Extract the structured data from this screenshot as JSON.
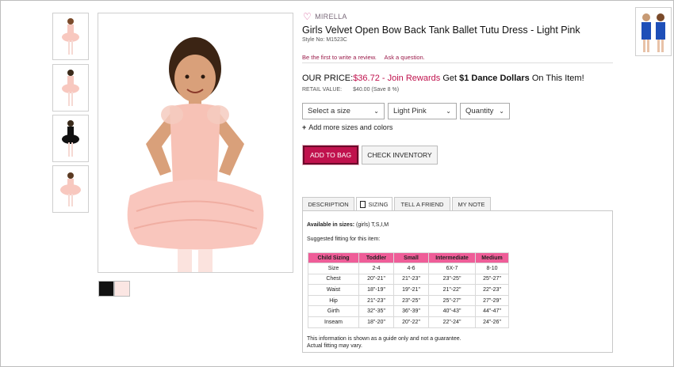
{
  "brand": "MIRELLA",
  "title": "Girls Velvet Open Bow Back Tank Ballet Tutu Dress - Light Pink",
  "style_no": "Style No: M1523C",
  "review_links": [
    "Be the first to write a review.",
    "Ask a question."
  ],
  "price": {
    "label": "OUR PRICE:",
    "amount": "$36.72",
    "join": " - Join Rewards",
    "get": " Get ",
    "reward": "$1 Dance Dollars",
    "tail": " On This Item!"
  },
  "retail": {
    "label": "RETAIL VALUE:",
    "value": "$40.00 (Save 8 %)"
  },
  "selects": {
    "size": "Select a size",
    "color": "Light Pink",
    "quantity": "Quantity"
  },
  "add_more": "Add more sizes and colors",
  "buttons": {
    "add_to_bag": "ADD TO BAG",
    "check_inventory": "CHECK INVENTORY"
  },
  "tabs": [
    "DESCRIPTION",
    "SIZING",
    "TELL A FRIEND",
    "MY NOTE"
  ],
  "sizing": {
    "avail_label": "Available in sizes:",
    "avail_value": " (girls) T,S,I,M",
    "suggested": "Suggested fitting for this item:",
    "headers": [
      "Child Sizing",
      "Toddler",
      "Small",
      "Intermediate",
      "Medium"
    ],
    "rows": [
      [
        "Size",
        "2-4",
        "4-6",
        "6X-7",
        "8-10"
      ],
      [
        "Chest",
        "20\"-21\"",
        "21\"-23\"",
        "23\"-25\"",
        "25\"-27\""
      ],
      [
        "Waist",
        "18\"-19\"",
        "19\"-21\"",
        "21\"-22\"",
        "22\"-23\""
      ],
      [
        "Hip",
        "21\"-23\"",
        "23\"-25\"",
        "25\"-27\"",
        "27\"-29\""
      ],
      [
        "Girth",
        "32\"-35\"",
        "36\"-39\"",
        "40\"-43\"",
        "44\"-47\""
      ],
      [
        "Inseam",
        "18\"-20\"",
        "20\"-22\"",
        "22\"-24\"",
        "24\"-26\""
      ]
    ],
    "disclaimer_1": "This information is shown as a guide only and not a guarantee.",
    "disclaimer_2": "Actual fitting may vary."
  },
  "colors": {
    "accent": "#c0124d",
    "table_header": "#ef5d98",
    "swatch_black": "#111111",
    "swatch_pink": "#fbe6e3"
  },
  "icons": {
    "favorite": "heart-icon",
    "dropdown": "chevron-down-icon",
    "add": "plus-icon"
  }
}
